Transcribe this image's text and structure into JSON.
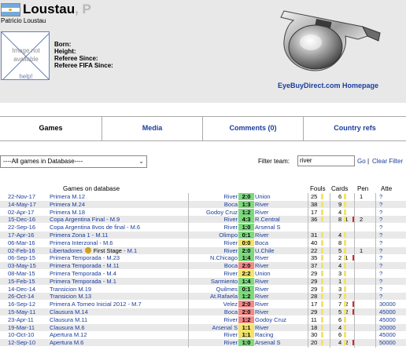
{
  "colors": {
    "win": "#7ed87e",
    "draw": "#f2e36b",
    "loss": "#f08a8a",
    "link": "#1a3d9c"
  },
  "referee": {
    "surname": "Loustau",
    "initial": ", P",
    "fullname": "Patricio Loustau"
  },
  "photo": {
    "placeholder_line1": "Image not",
    "placeholder_line2": "available",
    "help": "help!"
  },
  "info": {
    "born": "Born:",
    "height": "Height:",
    "referee_since": "Referee Since:",
    "referee_fifa_since": "Referee FIFA Since:"
  },
  "sponsor": {
    "link": "EyeBuyDirect.com Homepage"
  },
  "tabs": [
    {
      "label": "Games"
    },
    {
      "label": "Media"
    },
    {
      "label": "Comments (0)"
    },
    {
      "label": "Country refs"
    }
  ],
  "filter": {
    "select_value": "----All games in Database----",
    "filter_label": "Filter team:",
    "filter_value": "river",
    "go": "Go",
    "separator": "|",
    "clear": "Clear Filter"
  },
  "games_table": {
    "heading": "Games on database",
    "headers": {
      "fouls": "Fouls",
      "cards": "Cards",
      "pen": "Pen",
      "att": "Atte"
    },
    "rows": [
      {
        "date": "22-Nov-17",
        "comp": "Primera M.12",
        "stage": "",
        "m": "",
        "home": "River",
        "score": "2:0",
        "result": "win",
        "away": "Union",
        "fouls": "25",
        "fbar": true,
        "yel": "6",
        "red": "",
        "pen": "1",
        "att": "?"
      },
      {
        "date": "14-May-17",
        "comp": "Primera M.24",
        "stage": "",
        "m": "",
        "home": "Boca",
        "score": "1:3",
        "result": "win",
        "away": "River",
        "fouls": "38",
        "fbar": true,
        "yel": "9",
        "red": "",
        "pen": "",
        "att": "?"
      },
      {
        "date": "02-Apr-17",
        "comp": "Primera M.18",
        "stage": "",
        "m": "",
        "home": "Godoy Cruz",
        "score": "1:2",
        "result": "win",
        "away": "River",
        "fouls": "17",
        "fbar": true,
        "yel": "4",
        "red": "",
        "pen": "",
        "att": "?"
      },
      {
        "date": "15-Dec-16",
        "comp": "Copa Argentina Final",
        "stage": "",
        "m": " - M.9",
        "home": "River",
        "score": "4:3",
        "result": "win",
        "away": "R.Central",
        "fouls": "36",
        "fbar": true,
        "yel": "8",
        "red": "1",
        "pen": "2",
        "att": "?"
      },
      {
        "date": "22-Sep-16",
        "comp": "Copa Argentina 8vos de final",
        "stage": "",
        "m": " - M.6",
        "home": "River",
        "score": "1:0",
        "result": "win",
        "away": "Arsenal S",
        "fouls": "",
        "fbar": false,
        "yel": "",
        "red": "",
        "pen": "",
        "att": "?"
      },
      {
        "date": "17-Apr-16",
        "comp": "Primera Zona 1",
        "stage": "",
        "m": " - M.11",
        "home": "Olimpo",
        "score": "0:1",
        "result": "win",
        "away": "River",
        "fouls": "31",
        "fbar": true,
        "yel": "4",
        "red": "",
        "pen": "",
        "att": "?"
      },
      {
        "date": "06-Mar-16",
        "comp": "Primera Interzonal",
        "stage": "",
        "m": " - M.6",
        "home": "River",
        "score": "0:0",
        "result": "draw",
        "away": "Boca",
        "fouls": "40",
        "fbar": true,
        "yel": "8",
        "red": "",
        "pen": "",
        "att": "?"
      },
      {
        "date": "02-Feb-16",
        "comp": "Libertadores",
        "stage": "First Stage",
        "m": " - M.1",
        "home": "River",
        "score": "2:0",
        "result": "win",
        "away": "U.Chile",
        "fouls": "22",
        "fbar": true,
        "yel": "5",
        "red": "",
        "pen": "1",
        "att": "?"
      },
      {
        "date": "06-Sep-15",
        "comp": "Primera Temporada",
        "stage": "",
        "m": " - M.23",
        "home": "N.Chicago",
        "score": "1:4",
        "result": "win",
        "away": "River",
        "fouls": "35",
        "fbar": true,
        "yel": "2",
        "red": "1",
        "pen": "",
        "att": "?"
      },
      {
        "date": "03-May-15",
        "comp": "Primera Temporada",
        "stage": "",
        "m": " - M.11",
        "home": "Boca",
        "score": "2:0",
        "result": "loss",
        "away": "River",
        "fouls": "37",
        "fbar": true,
        "yel": "4",
        "red": "",
        "pen": "",
        "att": "?"
      },
      {
        "date": "08-Mar-15",
        "comp": "Primera Temporada",
        "stage": "",
        "m": " - M.4",
        "home": "River",
        "score": "2:2",
        "result": "draw",
        "away": "Union",
        "fouls": "29",
        "fbar": true,
        "yel": "3",
        "red": "",
        "pen": "",
        "att": "?"
      },
      {
        "date": "15-Feb-15",
        "comp": "Primera Temporada",
        "stage": "",
        "m": " - M.1",
        "home": "Sarmiento",
        "score": "1:4",
        "result": "win",
        "away": "River",
        "fouls": "29",
        "fbar": true,
        "yel": "1",
        "red": "",
        "pen": "",
        "att": "?"
      },
      {
        "date": "14-Dec-14",
        "comp": "Transicion M.19",
        "stage": "",
        "m": "",
        "home": "Quilmes",
        "score": "0:1",
        "result": "win",
        "away": "River",
        "fouls": "29",
        "fbar": true,
        "yel": "3",
        "red": "",
        "pen": "",
        "att": "?"
      },
      {
        "date": "26-Oct-14",
        "comp": "Transicion M.13",
        "stage": "",
        "m": "",
        "home": "At.Rafaela",
        "score": "1:2",
        "result": "win",
        "away": "River",
        "fouls": "28",
        "fbar": true,
        "yel": "7",
        "red": "",
        "pen": "",
        "att": "?"
      },
      {
        "date": "16-Sep-12",
        "comp": "Primera A Torneo Inicial 2012",
        "stage": "",
        "m": " - M.7",
        "home": "Velez",
        "score": "2:0",
        "result": "loss",
        "away": "River",
        "fouls": "17",
        "fbar": true,
        "yel": "7",
        "red": "2",
        "pen": "",
        "att": "30000"
      },
      {
        "date": "15-May-11",
        "comp": "Clausura M.14",
        "stage": "",
        "m": "",
        "home": "Boca",
        "score": "2:0",
        "result": "loss",
        "away": "River",
        "fouls": "29",
        "fbar": true,
        "yel": "5",
        "red": "2",
        "pen": "",
        "att": "45000"
      },
      {
        "date": "23-Apr-11",
        "comp": "Clausura M.11",
        "stage": "",
        "m": "",
        "home": "River",
        "score": "1:2",
        "result": "loss",
        "away": "Godoy Cruz",
        "fouls": "11",
        "fbar": true,
        "yel": "6",
        "red": "",
        "pen": "",
        "att": "45000"
      },
      {
        "date": "19-Mar-11",
        "comp": "Clausura M.6",
        "stage": "",
        "m": "",
        "home": "Arsenal S",
        "score": "1:1",
        "result": "draw",
        "away": "River",
        "fouls": "18",
        "fbar": true,
        "yel": "4",
        "red": "",
        "pen": "",
        "att": "20000"
      },
      {
        "date": "10-Oct-10",
        "comp": "Apertura M.12",
        "stage": "",
        "m": "",
        "home": "River",
        "score": "1:1",
        "result": "draw",
        "away": "Racing",
        "fouls": "30",
        "fbar": true,
        "yel": "6",
        "red": "",
        "pen": "",
        "att": "45000"
      },
      {
        "date": "12-Sep-10",
        "comp": "Apertura M.6",
        "stage": "",
        "m": "",
        "home": "River",
        "score": "1:0",
        "result": "win",
        "away": "Arsenal S",
        "fouls": "20",
        "fbar": true,
        "yel": "4",
        "red": "2",
        "pen": "",
        "att": "50000"
      }
    ]
  }
}
